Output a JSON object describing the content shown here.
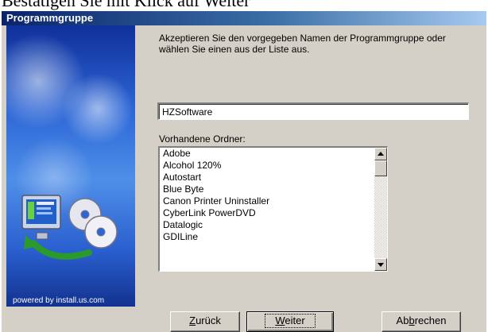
{
  "document_caption": "Bestätigen Sie mit Klick auf Weiter",
  "window": {
    "title": "Programmgruppe"
  },
  "side_panel": {
    "brand_text": "powered by install.us.com"
  },
  "instruction": "Akzeptieren Sie den vorgegeben Namen der Programmgruppe oder wählen Sie einen aus der Liste aus.",
  "group_name": {
    "value": "HZSoftware"
  },
  "folder_list": {
    "label": "Vorhandene Ordner:",
    "items": [
      "Adobe",
      "Alcohol 120%",
      "Autostart",
      "Blue Byte",
      "Canon Printer Uninstaller",
      "CyberLink PowerDVD",
      "Datalogic",
      "GDILine"
    ]
  },
  "buttons": {
    "back": {
      "label_pre": "",
      "label_key": "Z",
      "label_post": "urück"
    },
    "next": {
      "label_pre": "",
      "label_key": "W",
      "label_post": "eiter"
    },
    "cancel": {
      "label_pre": "Ab",
      "label_key": "b",
      "label_post": "rechen"
    }
  }
}
